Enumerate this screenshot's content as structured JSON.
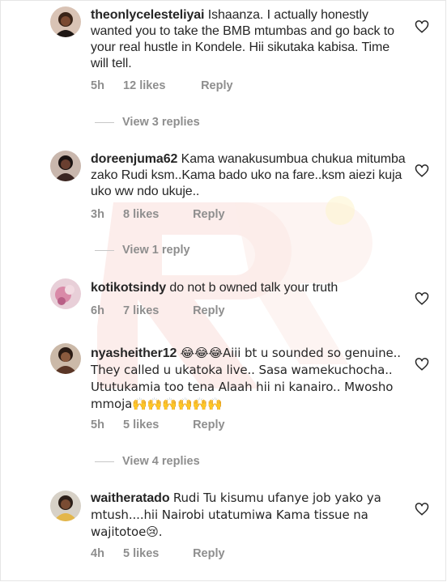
{
  "comments": [
    {
      "username": "theonlycelesteliyai",
      "text": "Ishaanza. I actually honestly wanted you to take the BMB mtumbas and go back to your real hustle in Kondele. Hii sikutaka kabisa. Time will tell.",
      "time": "5h",
      "likes": "12 likes",
      "reply": "Reply",
      "view_replies": "View 3 replies"
    },
    {
      "username": "doreenjuma62",
      "text": "Kama wanakusumbua chukua mitumba zako Rudi ksm..Kama bado uko na fare..ksm aiezi kuja uko ww ndo ukuje..",
      "time": "3h",
      "likes": "8 likes",
      "reply": "Reply",
      "view_replies": "View 1 reply"
    },
    {
      "username": "kotikotsindy",
      "text": "do not b owned talk your truth",
      "time": "6h",
      "likes": "7 likes",
      "reply": "Reply"
    },
    {
      "username": "nyasheither12",
      "text_before": "😂😂😂Aiii bt u sounded so genuine.. They called u ukatoka live.. Sasa wamekuchocha.. Ututukamia too tena Alaah hii ni kanairo.. Mwosho mmoja",
      "text_after": "🙌🙌🙌🙌🙌🙌",
      "time": "5h",
      "likes": "5 likes",
      "reply": "Reply",
      "view_replies": "View 4 replies"
    },
    {
      "username": "waitheratado",
      "text": "Rudi Tu kisumu ufanye job yako ya mtush....hii Nairobi utatumiwa Kama tissue na wajitotoe😢.",
      "time": "4h",
      "likes": "5 likes",
      "reply": "Reply"
    }
  ],
  "icons": {
    "like": "heart-outline-icon"
  },
  "colors": {
    "text": "#262626",
    "muted": "#8e8e8e",
    "watermark": "#f5d7d2"
  }
}
